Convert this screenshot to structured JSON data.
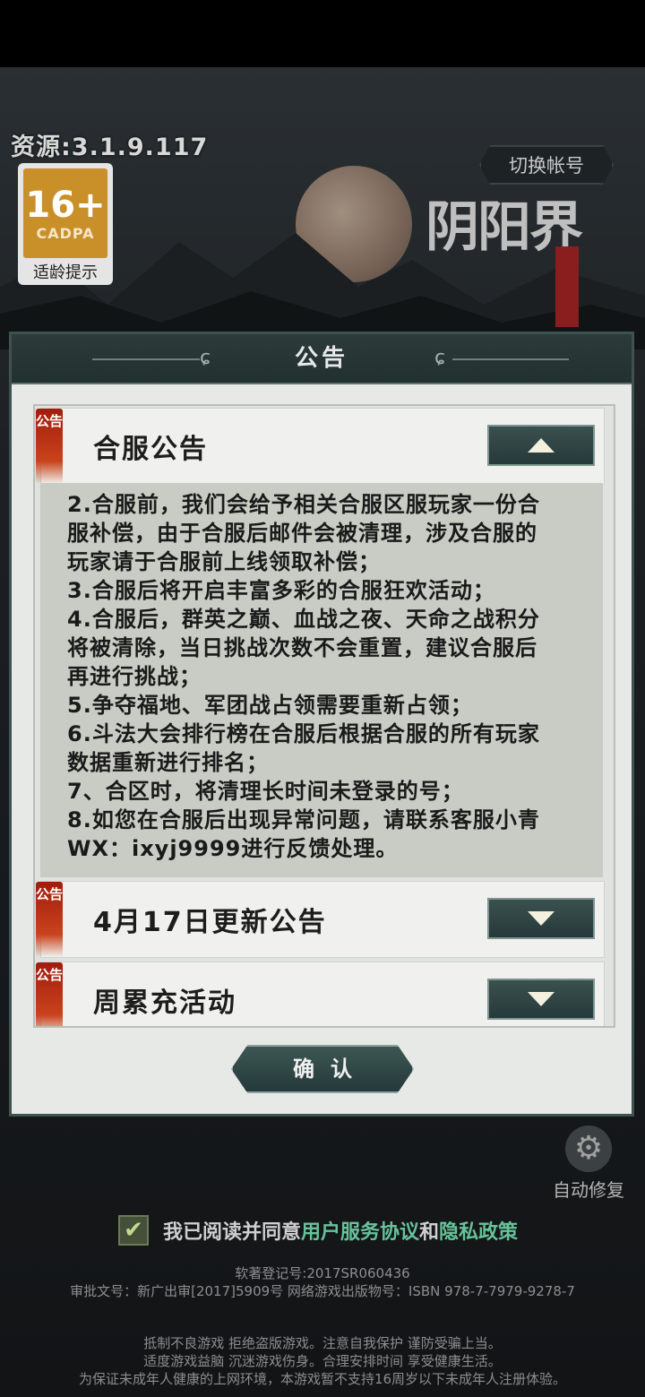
{
  "header": {
    "resource_version": "资源:3.1.9.117",
    "switch_account": "切换帐号",
    "logo_text": "阴阳界"
  },
  "age_rating": {
    "number": "16+",
    "org": "CADPA",
    "tip": "适龄提示"
  },
  "dialog": {
    "title": "公告",
    "tag_text": "公告",
    "items": [
      {
        "title": "合服公告",
        "expanded": true,
        "body": [
          "2.合服前，我们会给予相关合服区服玩家一份合",
          "服补偿，由于合服后邮件会被清理，涉及合服的",
          "玩家请于合服前上线领取补偿；",
          "3.合服后将开启丰富多彩的合服狂欢活动；",
          "4.合服后，群英之巅、血战之夜、天命之战积分",
          "将被清除，当日挑战次数不会重置，建议合服后",
          "再进行挑战；",
          "5.争夺福地、军团战占领需要重新占领；",
          "6.斗法大会排行榜在合服后根据合服的所有玩家",
          "数据重新进行排名；",
          "7、合区时，将清理长时间未登录的号；",
          "8.如您在合服后出现异常问题，请联系客服小青",
          "WX：ixyj9999进行反馈处理。"
        ]
      },
      {
        "title": "4月17日更新公告",
        "expanded": false
      },
      {
        "title": "周累充活动",
        "expanded": false
      }
    ],
    "confirm_label": "确认"
  },
  "auto_fix": {
    "label": "自动修复"
  },
  "agreement": {
    "text_prefix": "我已阅读并同意",
    "link_user": "用户服务协议",
    "text_and": "和",
    "link_privacy": "隐私政策"
  },
  "legal": {
    "line1": "软著登记号:2017SR060436",
    "line2": "审批文号：新广出审[2017]5909号 网络游戏出版物号：ISBN 978-7-7979-9278-7",
    "line3": "抵制不良游戏 拒绝盗版游戏。注意自我保护 谨防受骗上当。",
    "line4": "适度游戏益脑 沉迷游戏伤身。合理安排时间 享受健康生活。",
    "line5": "为保证未成年人健康的上网环境，本游戏暂不支持16周岁以下未成年人注册体验。"
  }
}
